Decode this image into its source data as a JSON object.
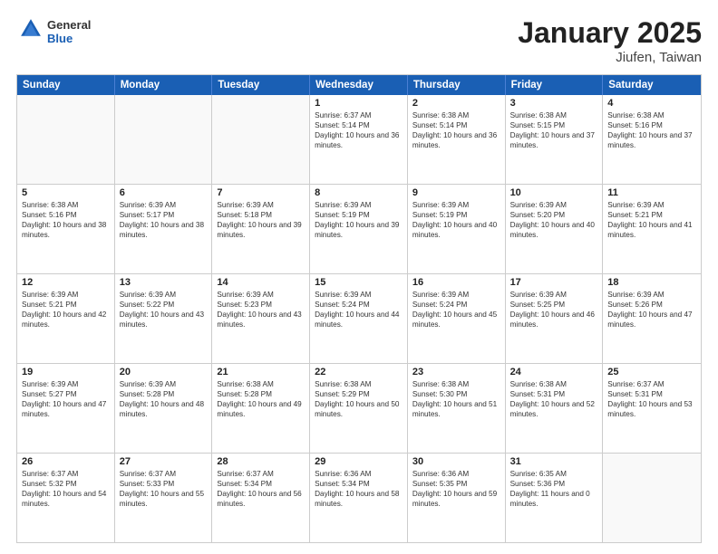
{
  "logo": {
    "general": "General",
    "blue": "Blue"
  },
  "header": {
    "month_year": "January 2025",
    "location": "Jiufen, Taiwan"
  },
  "day_headers": [
    "Sunday",
    "Monday",
    "Tuesday",
    "Wednesday",
    "Thursday",
    "Friday",
    "Saturday"
  ],
  "weeks": [
    [
      {
        "day": "",
        "empty": true
      },
      {
        "day": "",
        "empty": true
      },
      {
        "day": "",
        "empty": true
      },
      {
        "day": "1",
        "sunrise": "Sunrise: 6:37 AM",
        "sunset": "Sunset: 5:14 PM",
        "daylight": "Daylight: 10 hours and 36 minutes."
      },
      {
        "day": "2",
        "sunrise": "Sunrise: 6:38 AM",
        "sunset": "Sunset: 5:14 PM",
        "daylight": "Daylight: 10 hours and 36 minutes."
      },
      {
        "day": "3",
        "sunrise": "Sunrise: 6:38 AM",
        "sunset": "Sunset: 5:15 PM",
        "daylight": "Daylight: 10 hours and 37 minutes."
      },
      {
        "day": "4",
        "sunrise": "Sunrise: 6:38 AM",
        "sunset": "Sunset: 5:16 PM",
        "daylight": "Daylight: 10 hours and 37 minutes."
      }
    ],
    [
      {
        "day": "5",
        "sunrise": "Sunrise: 6:38 AM",
        "sunset": "Sunset: 5:16 PM",
        "daylight": "Daylight: 10 hours and 38 minutes."
      },
      {
        "day": "6",
        "sunrise": "Sunrise: 6:39 AM",
        "sunset": "Sunset: 5:17 PM",
        "daylight": "Daylight: 10 hours and 38 minutes."
      },
      {
        "day": "7",
        "sunrise": "Sunrise: 6:39 AM",
        "sunset": "Sunset: 5:18 PM",
        "daylight": "Daylight: 10 hours and 39 minutes."
      },
      {
        "day": "8",
        "sunrise": "Sunrise: 6:39 AM",
        "sunset": "Sunset: 5:19 PM",
        "daylight": "Daylight: 10 hours and 39 minutes."
      },
      {
        "day": "9",
        "sunrise": "Sunrise: 6:39 AM",
        "sunset": "Sunset: 5:19 PM",
        "daylight": "Daylight: 10 hours and 40 minutes."
      },
      {
        "day": "10",
        "sunrise": "Sunrise: 6:39 AM",
        "sunset": "Sunset: 5:20 PM",
        "daylight": "Daylight: 10 hours and 40 minutes."
      },
      {
        "day": "11",
        "sunrise": "Sunrise: 6:39 AM",
        "sunset": "Sunset: 5:21 PM",
        "daylight": "Daylight: 10 hours and 41 minutes."
      }
    ],
    [
      {
        "day": "12",
        "sunrise": "Sunrise: 6:39 AM",
        "sunset": "Sunset: 5:21 PM",
        "daylight": "Daylight: 10 hours and 42 minutes."
      },
      {
        "day": "13",
        "sunrise": "Sunrise: 6:39 AM",
        "sunset": "Sunset: 5:22 PM",
        "daylight": "Daylight: 10 hours and 43 minutes."
      },
      {
        "day": "14",
        "sunrise": "Sunrise: 6:39 AM",
        "sunset": "Sunset: 5:23 PM",
        "daylight": "Daylight: 10 hours and 43 minutes."
      },
      {
        "day": "15",
        "sunrise": "Sunrise: 6:39 AM",
        "sunset": "Sunset: 5:24 PM",
        "daylight": "Daylight: 10 hours and 44 minutes."
      },
      {
        "day": "16",
        "sunrise": "Sunrise: 6:39 AM",
        "sunset": "Sunset: 5:24 PM",
        "daylight": "Daylight: 10 hours and 45 minutes."
      },
      {
        "day": "17",
        "sunrise": "Sunrise: 6:39 AM",
        "sunset": "Sunset: 5:25 PM",
        "daylight": "Daylight: 10 hours and 46 minutes."
      },
      {
        "day": "18",
        "sunrise": "Sunrise: 6:39 AM",
        "sunset": "Sunset: 5:26 PM",
        "daylight": "Daylight: 10 hours and 47 minutes."
      }
    ],
    [
      {
        "day": "19",
        "sunrise": "Sunrise: 6:39 AM",
        "sunset": "Sunset: 5:27 PM",
        "daylight": "Daylight: 10 hours and 47 minutes."
      },
      {
        "day": "20",
        "sunrise": "Sunrise: 6:39 AM",
        "sunset": "Sunset: 5:28 PM",
        "daylight": "Daylight: 10 hours and 48 minutes."
      },
      {
        "day": "21",
        "sunrise": "Sunrise: 6:38 AM",
        "sunset": "Sunset: 5:28 PM",
        "daylight": "Daylight: 10 hours and 49 minutes."
      },
      {
        "day": "22",
        "sunrise": "Sunrise: 6:38 AM",
        "sunset": "Sunset: 5:29 PM",
        "daylight": "Daylight: 10 hours and 50 minutes."
      },
      {
        "day": "23",
        "sunrise": "Sunrise: 6:38 AM",
        "sunset": "Sunset: 5:30 PM",
        "daylight": "Daylight: 10 hours and 51 minutes."
      },
      {
        "day": "24",
        "sunrise": "Sunrise: 6:38 AM",
        "sunset": "Sunset: 5:31 PM",
        "daylight": "Daylight: 10 hours and 52 minutes."
      },
      {
        "day": "25",
        "sunrise": "Sunrise: 6:37 AM",
        "sunset": "Sunset: 5:31 PM",
        "daylight": "Daylight: 10 hours and 53 minutes."
      }
    ],
    [
      {
        "day": "26",
        "sunrise": "Sunrise: 6:37 AM",
        "sunset": "Sunset: 5:32 PM",
        "daylight": "Daylight: 10 hours and 54 minutes."
      },
      {
        "day": "27",
        "sunrise": "Sunrise: 6:37 AM",
        "sunset": "Sunset: 5:33 PM",
        "daylight": "Daylight: 10 hours and 55 minutes."
      },
      {
        "day": "28",
        "sunrise": "Sunrise: 6:37 AM",
        "sunset": "Sunset: 5:34 PM",
        "daylight": "Daylight: 10 hours and 56 minutes."
      },
      {
        "day": "29",
        "sunrise": "Sunrise: 6:36 AM",
        "sunset": "Sunset: 5:34 PM",
        "daylight": "Daylight: 10 hours and 58 minutes."
      },
      {
        "day": "30",
        "sunrise": "Sunrise: 6:36 AM",
        "sunset": "Sunset: 5:35 PM",
        "daylight": "Daylight: 10 hours and 59 minutes."
      },
      {
        "day": "31",
        "sunrise": "Sunrise: 6:35 AM",
        "sunset": "Sunset: 5:36 PM",
        "daylight": "Daylight: 11 hours and 0 minutes."
      },
      {
        "day": "",
        "empty": true
      }
    ]
  ]
}
